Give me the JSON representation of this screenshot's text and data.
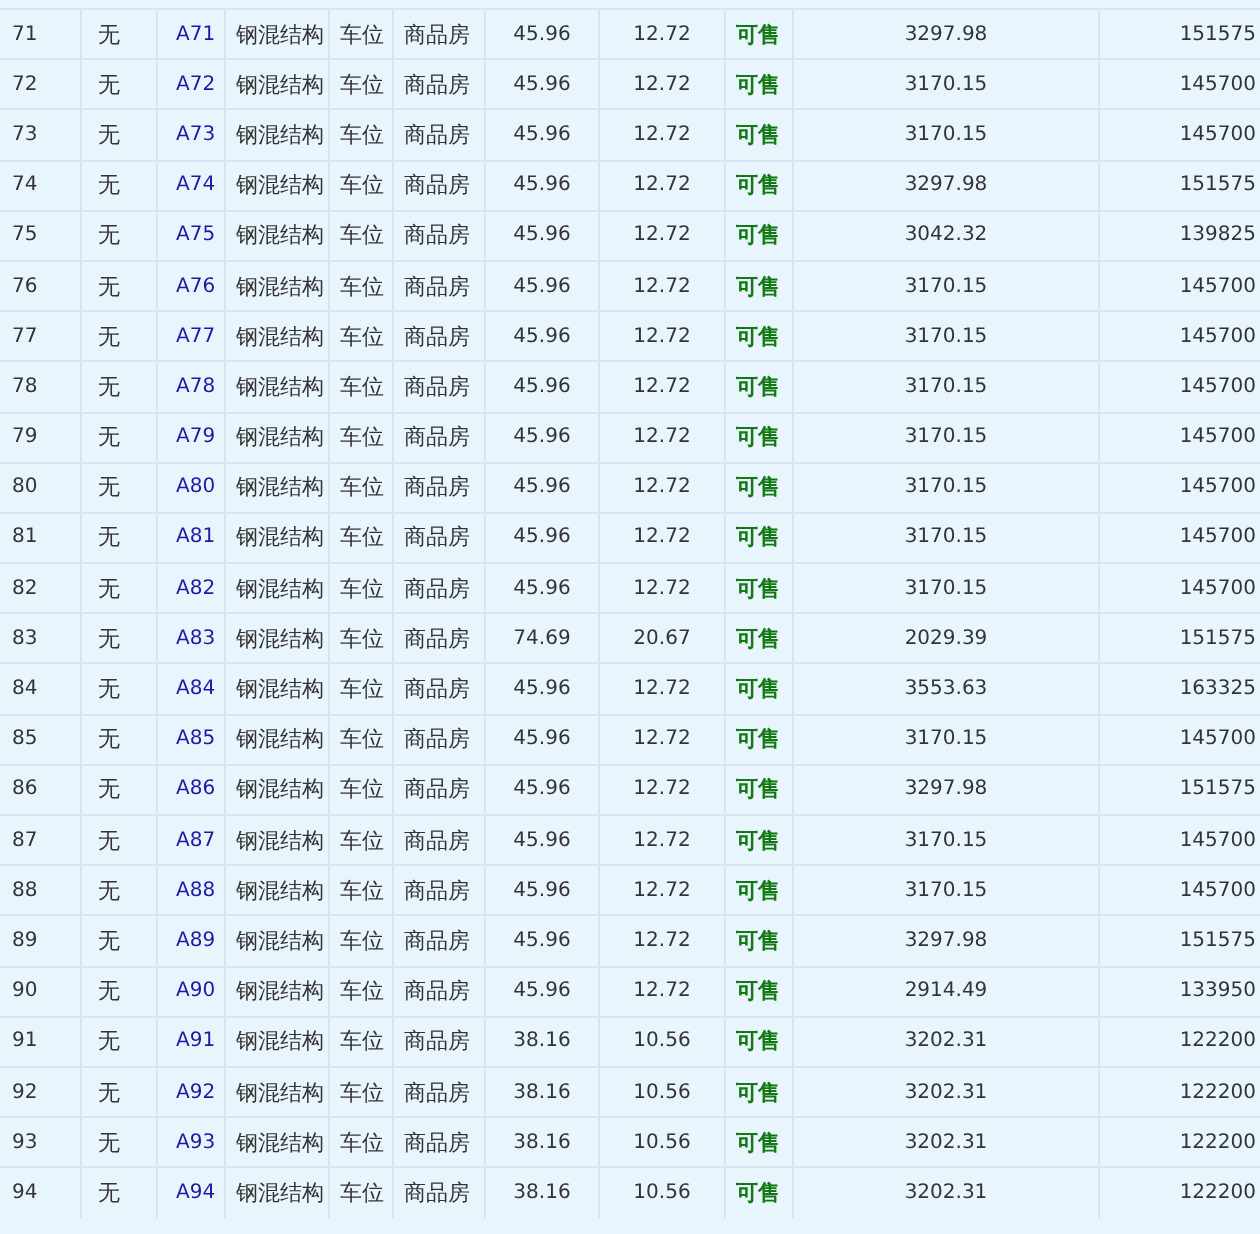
{
  "rows": [
    {
      "index": "71",
      "unit_type": "无",
      "room": "A71",
      "structure": "钢混结构",
      "use": "车位",
      "property": "商品房",
      "area": "45.96",
      "share_area": "12.72",
      "status": "可售",
      "unit_price": "3297.98",
      "total_price": "151575"
    },
    {
      "index": "72",
      "unit_type": "无",
      "room": "A72",
      "structure": "钢混结构",
      "use": "车位",
      "property": "商品房",
      "area": "45.96",
      "share_area": "12.72",
      "status": "可售",
      "unit_price": "3170.15",
      "total_price": "145700"
    },
    {
      "index": "73",
      "unit_type": "无",
      "room": "A73",
      "structure": "钢混结构",
      "use": "车位",
      "property": "商品房",
      "area": "45.96",
      "share_area": "12.72",
      "status": "可售",
      "unit_price": "3170.15",
      "total_price": "145700"
    },
    {
      "index": "74",
      "unit_type": "无",
      "room": "A74",
      "structure": "钢混结构",
      "use": "车位",
      "property": "商品房",
      "area": "45.96",
      "share_area": "12.72",
      "status": "可售",
      "unit_price": "3297.98",
      "total_price": "151575"
    },
    {
      "index": "75",
      "unit_type": "无",
      "room": "A75",
      "structure": "钢混结构",
      "use": "车位",
      "property": "商品房",
      "area": "45.96",
      "share_area": "12.72",
      "status": "可售",
      "unit_price": "3042.32",
      "total_price": "139825"
    },
    {
      "index": "76",
      "unit_type": "无",
      "room": "A76",
      "structure": "钢混结构",
      "use": "车位",
      "property": "商品房",
      "area": "45.96",
      "share_area": "12.72",
      "status": "可售",
      "unit_price": "3170.15",
      "total_price": "145700"
    },
    {
      "index": "77",
      "unit_type": "无",
      "room": "A77",
      "structure": "钢混结构",
      "use": "车位",
      "property": "商品房",
      "area": "45.96",
      "share_area": "12.72",
      "status": "可售",
      "unit_price": "3170.15",
      "total_price": "145700"
    },
    {
      "index": "78",
      "unit_type": "无",
      "room": "A78",
      "structure": "钢混结构",
      "use": "车位",
      "property": "商品房",
      "area": "45.96",
      "share_area": "12.72",
      "status": "可售",
      "unit_price": "3170.15",
      "total_price": "145700"
    },
    {
      "index": "79",
      "unit_type": "无",
      "room": "A79",
      "structure": "钢混结构",
      "use": "车位",
      "property": "商品房",
      "area": "45.96",
      "share_area": "12.72",
      "status": "可售",
      "unit_price": "3170.15",
      "total_price": "145700"
    },
    {
      "index": "80",
      "unit_type": "无",
      "room": "A80",
      "structure": "钢混结构",
      "use": "车位",
      "property": "商品房",
      "area": "45.96",
      "share_area": "12.72",
      "status": "可售",
      "unit_price": "3170.15",
      "total_price": "145700"
    },
    {
      "index": "81",
      "unit_type": "无",
      "room": "A81",
      "structure": "钢混结构",
      "use": "车位",
      "property": "商品房",
      "area": "45.96",
      "share_area": "12.72",
      "status": "可售",
      "unit_price": "3170.15",
      "total_price": "145700"
    },
    {
      "index": "82",
      "unit_type": "无",
      "room": "A82",
      "structure": "钢混结构",
      "use": "车位",
      "property": "商品房",
      "area": "45.96",
      "share_area": "12.72",
      "status": "可售",
      "unit_price": "3170.15",
      "total_price": "145700"
    },
    {
      "index": "83",
      "unit_type": "无",
      "room": "A83",
      "structure": "钢混结构",
      "use": "车位",
      "property": "商品房",
      "area": "74.69",
      "share_area": "20.67",
      "status": "可售",
      "unit_price": "2029.39",
      "total_price": "151575"
    },
    {
      "index": "84",
      "unit_type": "无",
      "room": "A84",
      "structure": "钢混结构",
      "use": "车位",
      "property": "商品房",
      "area": "45.96",
      "share_area": "12.72",
      "status": "可售",
      "unit_price": "3553.63",
      "total_price": "163325"
    },
    {
      "index": "85",
      "unit_type": "无",
      "room": "A85",
      "structure": "钢混结构",
      "use": "车位",
      "property": "商品房",
      "area": "45.96",
      "share_area": "12.72",
      "status": "可售",
      "unit_price": "3170.15",
      "total_price": "145700"
    },
    {
      "index": "86",
      "unit_type": "无",
      "room": "A86",
      "structure": "钢混结构",
      "use": "车位",
      "property": "商品房",
      "area": "45.96",
      "share_area": "12.72",
      "status": "可售",
      "unit_price": "3297.98",
      "total_price": "151575"
    },
    {
      "index": "87",
      "unit_type": "无",
      "room": "A87",
      "structure": "钢混结构",
      "use": "车位",
      "property": "商品房",
      "area": "45.96",
      "share_area": "12.72",
      "status": "可售",
      "unit_price": "3170.15",
      "total_price": "145700"
    },
    {
      "index": "88",
      "unit_type": "无",
      "room": "A88",
      "structure": "钢混结构",
      "use": "车位",
      "property": "商品房",
      "area": "45.96",
      "share_area": "12.72",
      "status": "可售",
      "unit_price": "3170.15",
      "total_price": "145700"
    },
    {
      "index": "89",
      "unit_type": "无",
      "room": "A89",
      "structure": "钢混结构",
      "use": "车位",
      "property": "商品房",
      "area": "45.96",
      "share_area": "12.72",
      "status": "可售",
      "unit_price": "3297.98",
      "total_price": "151575"
    },
    {
      "index": "90",
      "unit_type": "无",
      "room": "A90",
      "structure": "钢混结构",
      "use": "车位",
      "property": "商品房",
      "area": "45.96",
      "share_area": "12.72",
      "status": "可售",
      "unit_price": "2914.49",
      "total_price": "133950"
    },
    {
      "index": "91",
      "unit_type": "无",
      "room": "A91",
      "structure": "钢混结构",
      "use": "车位",
      "property": "商品房",
      "area": "38.16",
      "share_area": "10.56",
      "status": "可售",
      "unit_price": "3202.31",
      "total_price": "122200"
    },
    {
      "index": "92",
      "unit_type": "无",
      "room": "A92",
      "structure": "钢混结构",
      "use": "车位",
      "property": "商品房",
      "area": "38.16",
      "share_area": "10.56",
      "status": "可售",
      "unit_price": "3202.31",
      "total_price": "122200"
    },
    {
      "index": "93",
      "unit_type": "无",
      "room": "A93",
      "structure": "钢混结构",
      "use": "车位",
      "property": "商品房",
      "area": "38.16",
      "share_area": "10.56",
      "status": "可售",
      "unit_price": "3202.31",
      "total_price": "122200"
    },
    {
      "index": "94",
      "unit_type": "无",
      "room": "A94",
      "structure": "钢混结构",
      "use": "车位",
      "property": "商品房",
      "area": "38.16",
      "share_area": "10.56",
      "status": "可售",
      "unit_price": "3202.31",
      "total_price": "122200"
    }
  ]
}
